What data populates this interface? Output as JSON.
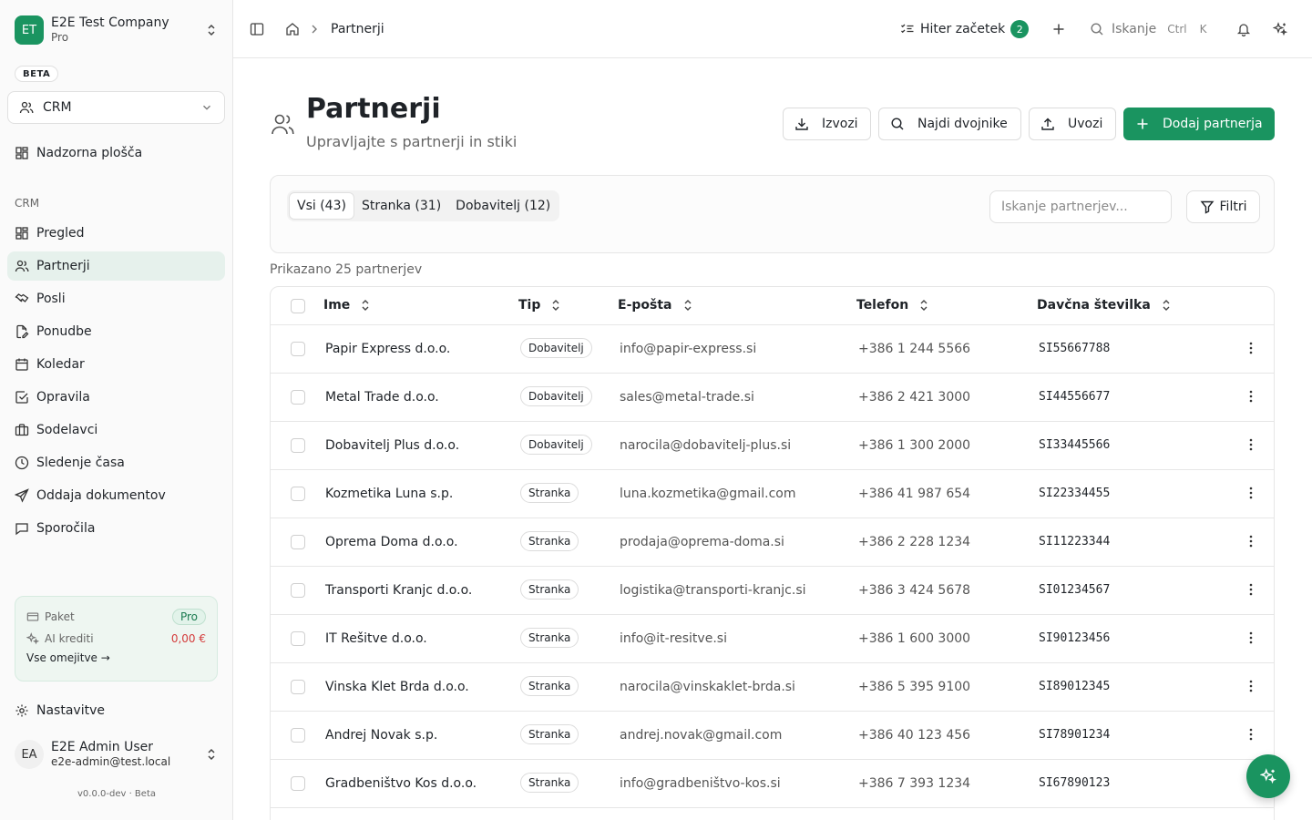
{
  "company": {
    "initials": "ET",
    "name": "E2E Test Company",
    "plan": "Pro"
  },
  "beta_label": "BETA",
  "module": {
    "label": "CRM"
  },
  "nav_top": {
    "label": "Nadzorna plošča"
  },
  "nav_section": "CRM",
  "nav": [
    {
      "label": "Pregled",
      "icon": "grid-icon"
    },
    {
      "label": "Partnerji",
      "icon": "users-icon",
      "active": true
    },
    {
      "label": "Posli",
      "icon": "handshake-icon"
    },
    {
      "label": "Ponudbe",
      "icon": "file-edit-icon"
    },
    {
      "label": "Koledar",
      "icon": "calendar-icon"
    },
    {
      "label": "Opravila",
      "icon": "check-square-icon"
    },
    {
      "label": "Sodelavci",
      "icon": "briefcase-icon"
    },
    {
      "label": "Sledenje časa",
      "icon": "clock-icon"
    },
    {
      "label": "Oddaja dokumentov",
      "icon": "send-icon"
    },
    {
      "label": "Sporočila",
      "icon": "message-icon"
    }
  ],
  "plan_card": {
    "plan_label": "Paket",
    "plan_value": "Pro",
    "credits_label": "AI krediti",
    "credits_value": "0,00 €",
    "limits_link": "Vse omejitve →"
  },
  "settings_label": "Nastavitve",
  "user": {
    "initials": "EA",
    "name": "E2E Admin User",
    "email": "e2e-admin@test.local"
  },
  "version": "v0.0.0-dev · Beta",
  "topbar": {
    "breadcrumb": "Partnerji",
    "quick_start": "Hiter začetek",
    "quick_start_count": "2",
    "search_label": "Iskanje",
    "search_kbd1": "Ctrl",
    "search_kbd2": "K"
  },
  "page": {
    "title": "Partnerji",
    "subtitle": "Upravljajte s partnerji in stiki",
    "buttons": {
      "export": "Izvozi",
      "find_duplicates": "Najdi dvojnike",
      "import": "Uvozi",
      "add": "Dodaj partnerja"
    }
  },
  "filters": {
    "tabs": [
      {
        "label": "Vsi (43)",
        "active": true
      },
      {
        "label": "Stranka (31)"
      },
      {
        "label": "Dobavitelj (12)"
      }
    ],
    "search_placeholder": "Iskanje partnerjev...",
    "filter_button": "Filtri"
  },
  "showing_text": "Prikazano 25 partnerjev",
  "table": {
    "columns": [
      "Ime",
      "Tip",
      "E-pošta",
      "Telefon",
      "Davčna številka"
    ],
    "rows": [
      {
        "name": "Papir Express d.o.o.",
        "type": "Dobavitelj",
        "email": "info@papir-express.si",
        "phone": "+386 1 244 5566",
        "tax": "SI55667788"
      },
      {
        "name": "Metal Trade d.o.o.",
        "type": "Dobavitelj",
        "email": "sales@metal-trade.si",
        "phone": "+386 2 421 3000",
        "tax": "SI44556677"
      },
      {
        "name": "Dobavitelj Plus d.o.o.",
        "type": "Dobavitelj",
        "email": "narocila@dobavitelj-plus.si",
        "phone": "+386 1 300 2000",
        "tax": "SI33445566"
      },
      {
        "name": "Kozmetika Luna s.p.",
        "type": "Stranka",
        "email": "luna.kozmetika@gmail.com",
        "phone": "+386 41 987 654",
        "tax": "SI22334455"
      },
      {
        "name": "Oprema Doma d.o.o.",
        "type": "Stranka",
        "email": "prodaja@oprema-doma.si",
        "phone": "+386 2 228 1234",
        "tax": "SI11223344"
      },
      {
        "name": "Transporti Kranjc d.o.o.",
        "type": "Stranka",
        "email": "logistika@transporti-kranjc.si",
        "phone": "+386 3 424 5678",
        "tax": "SI01234567"
      },
      {
        "name": "IT Rešitve d.o.o.",
        "type": "Stranka",
        "email": "info@it-resitve.si",
        "phone": "+386 1 600 3000",
        "tax": "SI90123456"
      },
      {
        "name": "Vinska Klet Brda d.o.o.",
        "type": "Stranka",
        "email": "narocila@vinskaklet-brda.si",
        "phone": "+386 5 395 9100",
        "tax": "SI89012345"
      },
      {
        "name": "Andrej Novak s.p.",
        "type": "Stranka",
        "email": "andrej.novak@gmail.com",
        "phone": "+386 40 123 456",
        "tax": "SI78901234"
      },
      {
        "name": "Gradbeništvo Kos d.o.o.",
        "type": "Stranka",
        "email": "info@gradbeništvo-kos.si",
        "phone": "+386 7 393 1234",
        "tax": "SI67890123"
      }
    ]
  },
  "colors": {
    "accent": "#1a9460",
    "active_nav_bg": "#e6f1ec",
    "credits": "#d43b3b"
  }
}
